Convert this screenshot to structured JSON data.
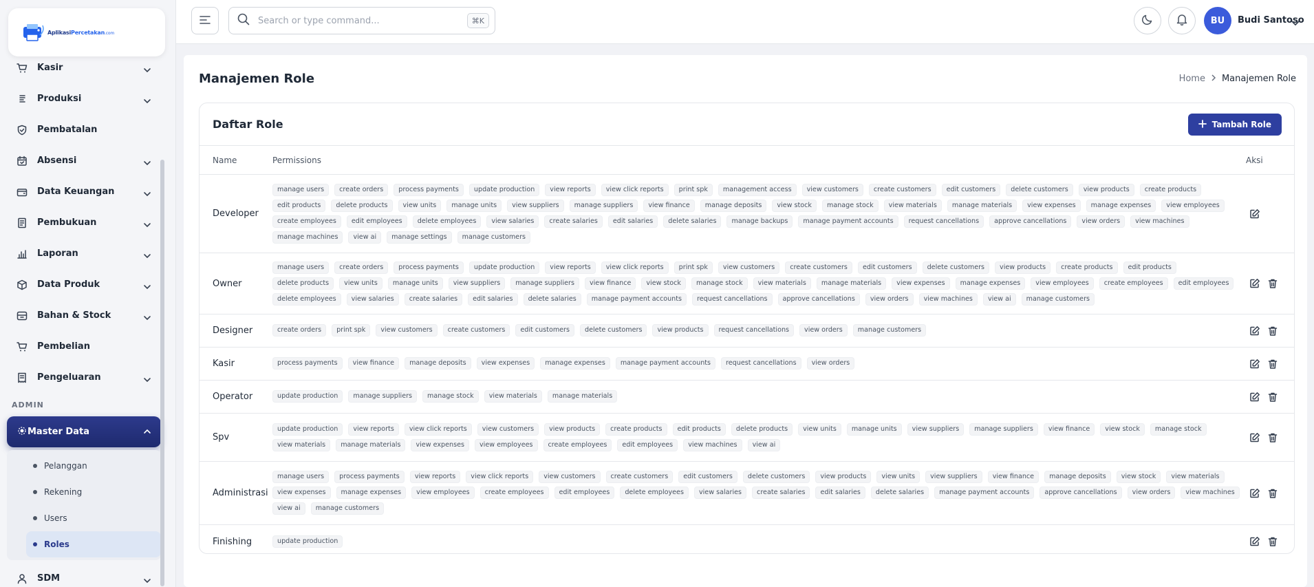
{
  "app": {
    "logo_main": "Aplikasi",
    "logo_accent": "Percetakan",
    "logo_suffix": ".com"
  },
  "sidebar": {
    "items": [
      {
        "label": "Kasir",
        "icon": "cart-icon",
        "has_submenu": true
      },
      {
        "label": "Produksi",
        "icon": "document-list-icon",
        "has_submenu": true
      },
      {
        "label": "Pembatalan",
        "icon": "shield-icon",
        "has_submenu": false
      },
      {
        "label": "Absensi",
        "icon": "calendar-check-icon",
        "has_submenu": true
      },
      {
        "label": "Data Keuangan",
        "icon": "wallet-icon",
        "has_submenu": true
      },
      {
        "label": "Pembukuan",
        "icon": "book-icon",
        "has_submenu": true
      },
      {
        "label": "Laporan",
        "icon": "bar-chart-icon",
        "has_submenu": true
      },
      {
        "label": "Data Produk",
        "icon": "box-icon",
        "has_submenu": true
      },
      {
        "label": "Bahan & Stock",
        "icon": "archive-icon",
        "has_submenu": true
      },
      {
        "label": "Pembelian",
        "icon": "cart-icon",
        "has_submenu": false
      },
      {
        "label": "Pengeluaran",
        "icon": "receipt-icon",
        "has_submenu": true
      }
    ],
    "section_admin": "ADMIN",
    "active_group": {
      "label": "Master Data",
      "subitems": [
        "Pelanggan",
        "Rekening",
        "Users",
        "Roles"
      ],
      "active_subitem": "Roles"
    },
    "next_item": "SDM"
  },
  "topbar": {
    "search_placeholder": "Search or type command...",
    "shortcut": "⌘K",
    "avatar_initials": "BU",
    "user_name": "Budi Santoso"
  },
  "page": {
    "title": "Manajemen Role",
    "breadcrumb_home": "Home",
    "breadcrumb_current": "Manajemen Role"
  },
  "card": {
    "title": "Daftar Role",
    "add_button": "Tambah Role",
    "columns": {
      "name": "Name",
      "permissions": "Permissions",
      "actions": "Aksi"
    }
  },
  "roles": [
    {
      "name": "Developer",
      "deletable": false,
      "permissions": [
        "manage users",
        "create orders",
        "process payments",
        "update production",
        "view reports",
        "view click reports",
        "print spk",
        "management access",
        "view customers",
        "create customers",
        "edit customers",
        "delete customers",
        "view products",
        "create products",
        "edit products",
        "delete products",
        "view units",
        "manage units",
        "view suppliers",
        "manage suppliers",
        "view finance",
        "manage deposits",
        "view stock",
        "manage stock",
        "view materials",
        "manage materials",
        "view expenses",
        "manage expenses",
        "view employees",
        "create employees",
        "edit employees",
        "delete employees",
        "view salaries",
        "create salaries",
        "edit salaries",
        "delete salaries",
        "manage backups",
        "manage payment accounts",
        "request cancellations",
        "approve cancellations",
        "view orders",
        "view machines",
        "manage machines",
        "view ai",
        "manage settings",
        "manage customers"
      ]
    },
    {
      "name": "Owner",
      "deletable": true,
      "permissions": [
        "manage users",
        "create orders",
        "process payments",
        "update production",
        "view reports",
        "view click reports",
        "print spk",
        "view customers",
        "create customers",
        "edit customers",
        "delete customers",
        "view products",
        "create products",
        "edit products",
        "delete products",
        "view units",
        "manage units",
        "view suppliers",
        "manage suppliers",
        "view finance",
        "view stock",
        "manage stock",
        "view materials",
        "manage materials",
        "view expenses",
        "manage expenses",
        "view employees",
        "create employees",
        "edit employees",
        "delete employees",
        "view salaries",
        "create salaries",
        "edit salaries",
        "delete salaries",
        "manage payment accounts",
        "request cancellations",
        "approve cancellations",
        "view orders",
        "view machines",
        "view ai",
        "manage customers"
      ]
    },
    {
      "name": "Designer",
      "deletable": true,
      "permissions": [
        "create orders",
        "print spk",
        "view customers",
        "create customers",
        "edit customers",
        "delete customers",
        "view products",
        "request cancellations",
        "view orders",
        "manage customers"
      ]
    },
    {
      "name": "Kasir",
      "deletable": true,
      "permissions": [
        "process payments",
        "view finance",
        "manage deposits",
        "view expenses",
        "manage expenses",
        "manage payment accounts",
        "request cancellations",
        "view orders"
      ]
    },
    {
      "name": "Operator",
      "deletable": true,
      "permissions": [
        "update production",
        "manage suppliers",
        "manage stock",
        "view materials",
        "manage materials"
      ]
    },
    {
      "name": "Spv",
      "deletable": true,
      "permissions": [
        "update production",
        "view reports",
        "view click reports",
        "view customers",
        "view products",
        "create products",
        "edit products",
        "delete products",
        "view units",
        "manage units",
        "view suppliers",
        "manage suppliers",
        "view finance",
        "view stock",
        "manage stock",
        "view materials",
        "manage materials",
        "view expenses",
        "view employees",
        "create employees",
        "edit employees",
        "view machines",
        "view ai"
      ]
    },
    {
      "name": "Administrasi",
      "deletable": true,
      "permissions": [
        "manage users",
        "process payments",
        "view reports",
        "view click reports",
        "view customers",
        "create customers",
        "edit customers",
        "delete customers",
        "view products",
        "view units",
        "view suppliers",
        "view finance",
        "manage deposits",
        "view stock",
        "view materials",
        "view expenses",
        "manage expenses",
        "view employees",
        "create employees",
        "edit employees",
        "delete employees",
        "view salaries",
        "create salaries",
        "edit salaries",
        "delete salaries",
        "manage payment accounts",
        "approve cancellations",
        "view orders",
        "view machines",
        "view ai",
        "manage customers"
      ]
    },
    {
      "name": "Finishing",
      "deletable": true,
      "permissions": [
        "update production"
      ]
    }
  ],
  "colors": {
    "accent": "#2e3fa0",
    "active_nav": "#1e2a6e",
    "avatar": "#3b5bdb"
  }
}
